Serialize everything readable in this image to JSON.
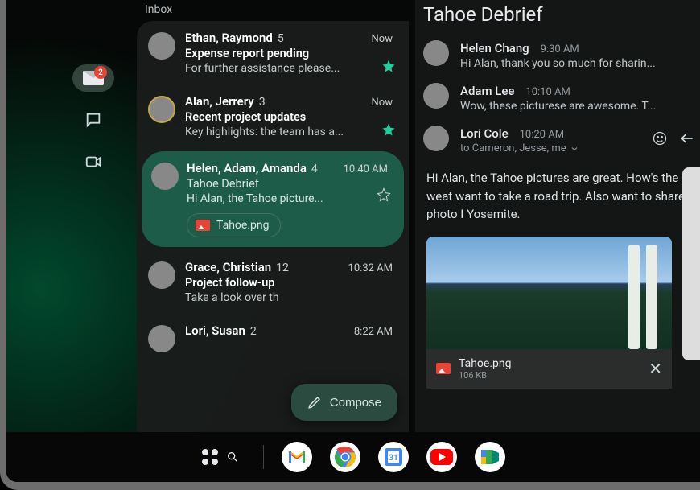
{
  "inbox_label": "Inbox",
  "rail": {
    "mail_badge": "2"
  },
  "threads": [
    {
      "sender": "Ethan, Raymond",
      "count": "5",
      "time": "Now",
      "subject": "Expense report pending",
      "snippet": "For further assistance please...",
      "starred": true
    },
    {
      "sender": "Alan, Jerrery",
      "count": "3",
      "time": "Now",
      "subject": "Recent project updates",
      "snippet": "Key highlights: the team has a...",
      "starred": true
    },
    {
      "sender": "Helen, Adam, Amanda",
      "count": "4",
      "time": "10:40 AM",
      "subject": "Tahoe Debrief",
      "snippet": "Hi Alan, the Tahoe picture...",
      "starred": false,
      "attachment": "Tahoe.png"
    },
    {
      "sender": "Grace, Christian",
      "count": "12",
      "time": "10:32 AM",
      "subject": "Project follow-up",
      "snippet": "Take a look over th"
    },
    {
      "sender": "Lori, Susan",
      "count": "2",
      "time": "8:22 AM"
    }
  ],
  "compose_label": "Compose",
  "conversation": {
    "title": "Tahoe Debrief",
    "messages": [
      {
        "from": "Helen Chang",
        "time": "9:30 AM",
        "text": "Hi Alan, thank you so much for sharin..."
      },
      {
        "from": "Adam Lee",
        "time": "10:10 AM",
        "text": "Wow, these picturese are awesome. T..."
      },
      {
        "from": "Lori Cole",
        "time": "10:20 AM",
        "recipients": "to Cameron, Jesse, me"
      }
    ],
    "body": "Hi Alan, the Tahoe pictures are great. How's the weat want to take a road trip. Also want to share a photo I Yosemite.",
    "attachment": {
      "name": "Tahoe.png",
      "size": "106 KB"
    }
  }
}
